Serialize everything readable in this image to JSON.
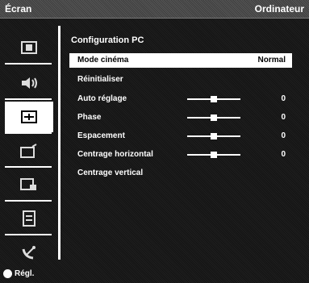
{
  "header": {
    "title": "Écran",
    "source": "Ordinateur"
  },
  "sidebar": {
    "items": [
      {
        "icon": "picture-icon",
        "active": false
      },
      {
        "icon": "speaker-icon",
        "active": false
      },
      {
        "icon": "screen-adjust-icon",
        "active": true
      },
      {
        "icon": "channel-icon",
        "active": false
      },
      {
        "icon": "lock-icon",
        "active": false
      },
      {
        "icon": "list-icon",
        "active": false
      },
      {
        "icon": "satellite-icon",
        "active": false
      }
    ]
  },
  "menu": {
    "heading": "Configuration PC",
    "rows": [
      {
        "label": "Mode cinéma",
        "value": "Normal",
        "selected": true,
        "slider": null
      },
      {
        "label": "Réinitialiser",
        "value": "",
        "selected": false,
        "slider": null
      },
      {
        "label": "Auto réglage",
        "value": "0",
        "selected": false,
        "slider": 0.5
      },
      {
        "label": "Phase",
        "value": "0",
        "selected": false,
        "slider": 0.5
      },
      {
        "label": "Espacement",
        "value": "0",
        "selected": false,
        "slider": 0.5
      },
      {
        "label": "Centrage horizontal",
        "value": "0",
        "selected": false,
        "slider": 0.5
      },
      {
        "label": "Centrage vertical",
        "value": "",
        "selected": false,
        "slider": null
      }
    ]
  },
  "footer": {
    "hint": "Régl."
  }
}
